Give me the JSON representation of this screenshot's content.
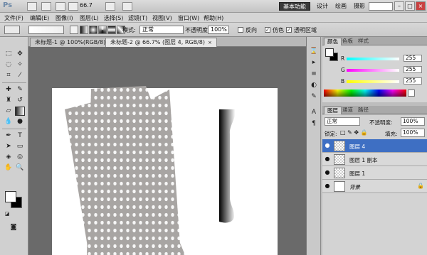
{
  "appbar": {
    "logo": "Ps",
    "zoom": "66.7",
    "workspaces": [
      "基本功能",
      "设计",
      "绘画",
      "摄影"
    ],
    "win_controls": [
      "–",
      "□",
      "×"
    ]
  },
  "menu": [
    "文件(F)",
    "编辑(E)",
    "图像(I)",
    "图层(L)",
    "选择(S)",
    "滤镜(T)",
    "视图(V)",
    "窗口(W)",
    "帮助(H)"
  ],
  "options": {
    "mode_label": "模式:",
    "mode_value": "正常",
    "opacity_label": "不透明度:",
    "opacity_value": "100%",
    "reverse_label": "反向",
    "dither_label": "仿色",
    "transparency_label": "透明区域",
    "reverse_checked": false,
    "dither_checked": true,
    "transparency_checked": true
  },
  "doc_tabs": [
    {
      "label": "未标题-1 @ 100%(RGB/8)",
      "close": "×"
    },
    {
      "label": "未标题-2 @ 66.7% (图层 4, RGB/8)",
      "close": "×"
    }
  ],
  "color_panel": {
    "tabs": [
      "颜色",
      "色板",
      "样式"
    ],
    "channels": [
      {
        "name": "R",
        "value": "255",
        "track": "linear-gradient(to right, #00ffff, #ffffff)"
      },
      {
        "name": "G",
        "value": "255",
        "track": "linear-gradient(to right, #ff00ff, #ffffff)"
      },
      {
        "name": "B",
        "value": "255",
        "track": "linear-gradient(to right, #ffff00, #ffffff)"
      }
    ]
  },
  "layers_panel": {
    "tabs": [
      "图层",
      "通道",
      "路径"
    ],
    "blend_mode": "正常",
    "opacity_label": "不透明度:",
    "opacity_value": "100%",
    "lock_label": "锁定:",
    "fill_label": "填充:",
    "fill_value": "100%",
    "layers": [
      {
        "name": "图层 4",
        "selected": true
      },
      {
        "name": "图层 1 副本",
        "selected": false
      },
      {
        "name": "图层 1",
        "selected": false
      },
      {
        "name": "背景",
        "selected": false,
        "locked": true
      }
    ]
  },
  "colors": {
    "selected_layer": "#3e6fc3",
    "card": "#a8a5a3",
    "canvas_bg": "#6a6a6a"
  }
}
